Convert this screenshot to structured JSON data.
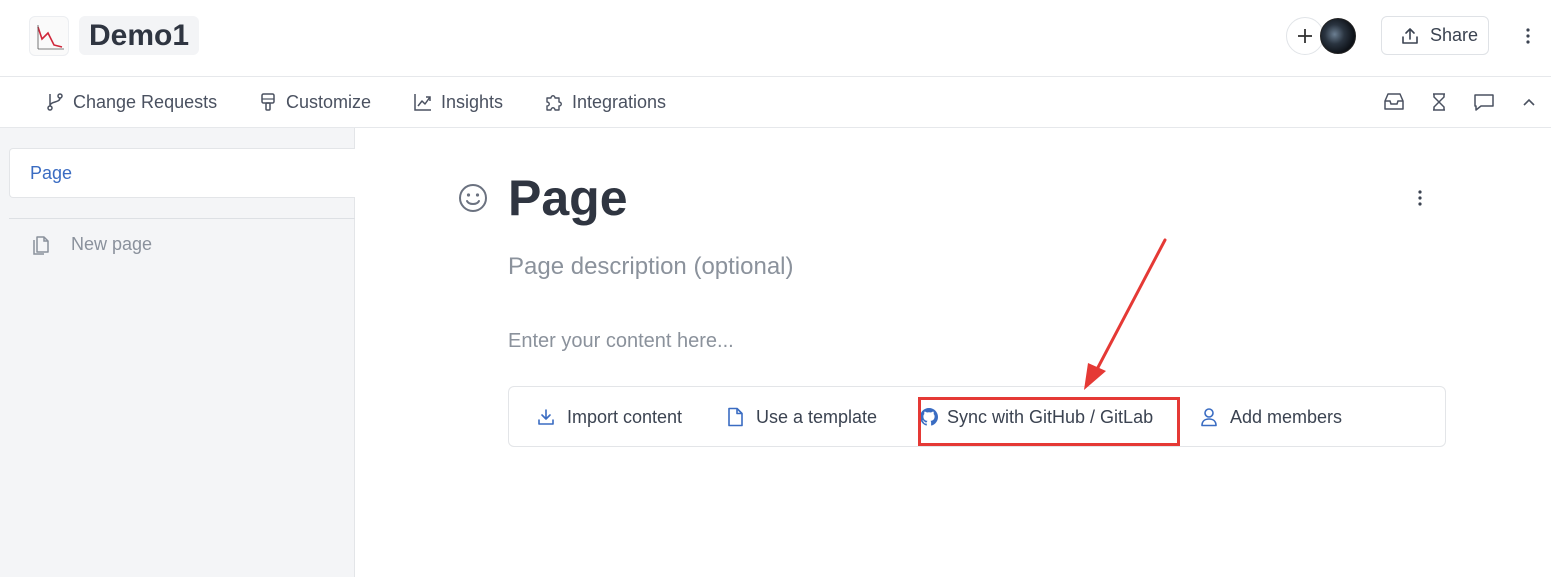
{
  "header": {
    "space_title": "Demo1",
    "share_label": "Share"
  },
  "subnav": {
    "items": [
      {
        "label": "Change Requests",
        "icon": "branch-icon"
      },
      {
        "label": "Customize",
        "icon": "paintbrush-icon"
      },
      {
        "label": "Insights",
        "icon": "chart-line-icon"
      },
      {
        "label": "Integrations",
        "icon": "puzzle-icon"
      }
    ],
    "right_icons": [
      "inbox-icon",
      "hourglass-icon",
      "comment-icon",
      "chevron-up-icon"
    ]
  },
  "sidebar": {
    "page_label": "Page",
    "new_page_label": "New page"
  },
  "main": {
    "title": "Page",
    "description_placeholder": "Page description (optional)",
    "content_placeholder": "Enter your content here...",
    "actions": [
      {
        "label": "Import content",
        "icon": "download-icon"
      },
      {
        "label": "Use a template",
        "icon": "document-icon"
      },
      {
        "label": "Sync with GitHub / GitLab",
        "icon": "github-icon"
      },
      {
        "label": "Add members",
        "icon": "user-icon"
      }
    ]
  },
  "colors": {
    "accent": "#3a6cc2",
    "annotation": "#e53935"
  }
}
